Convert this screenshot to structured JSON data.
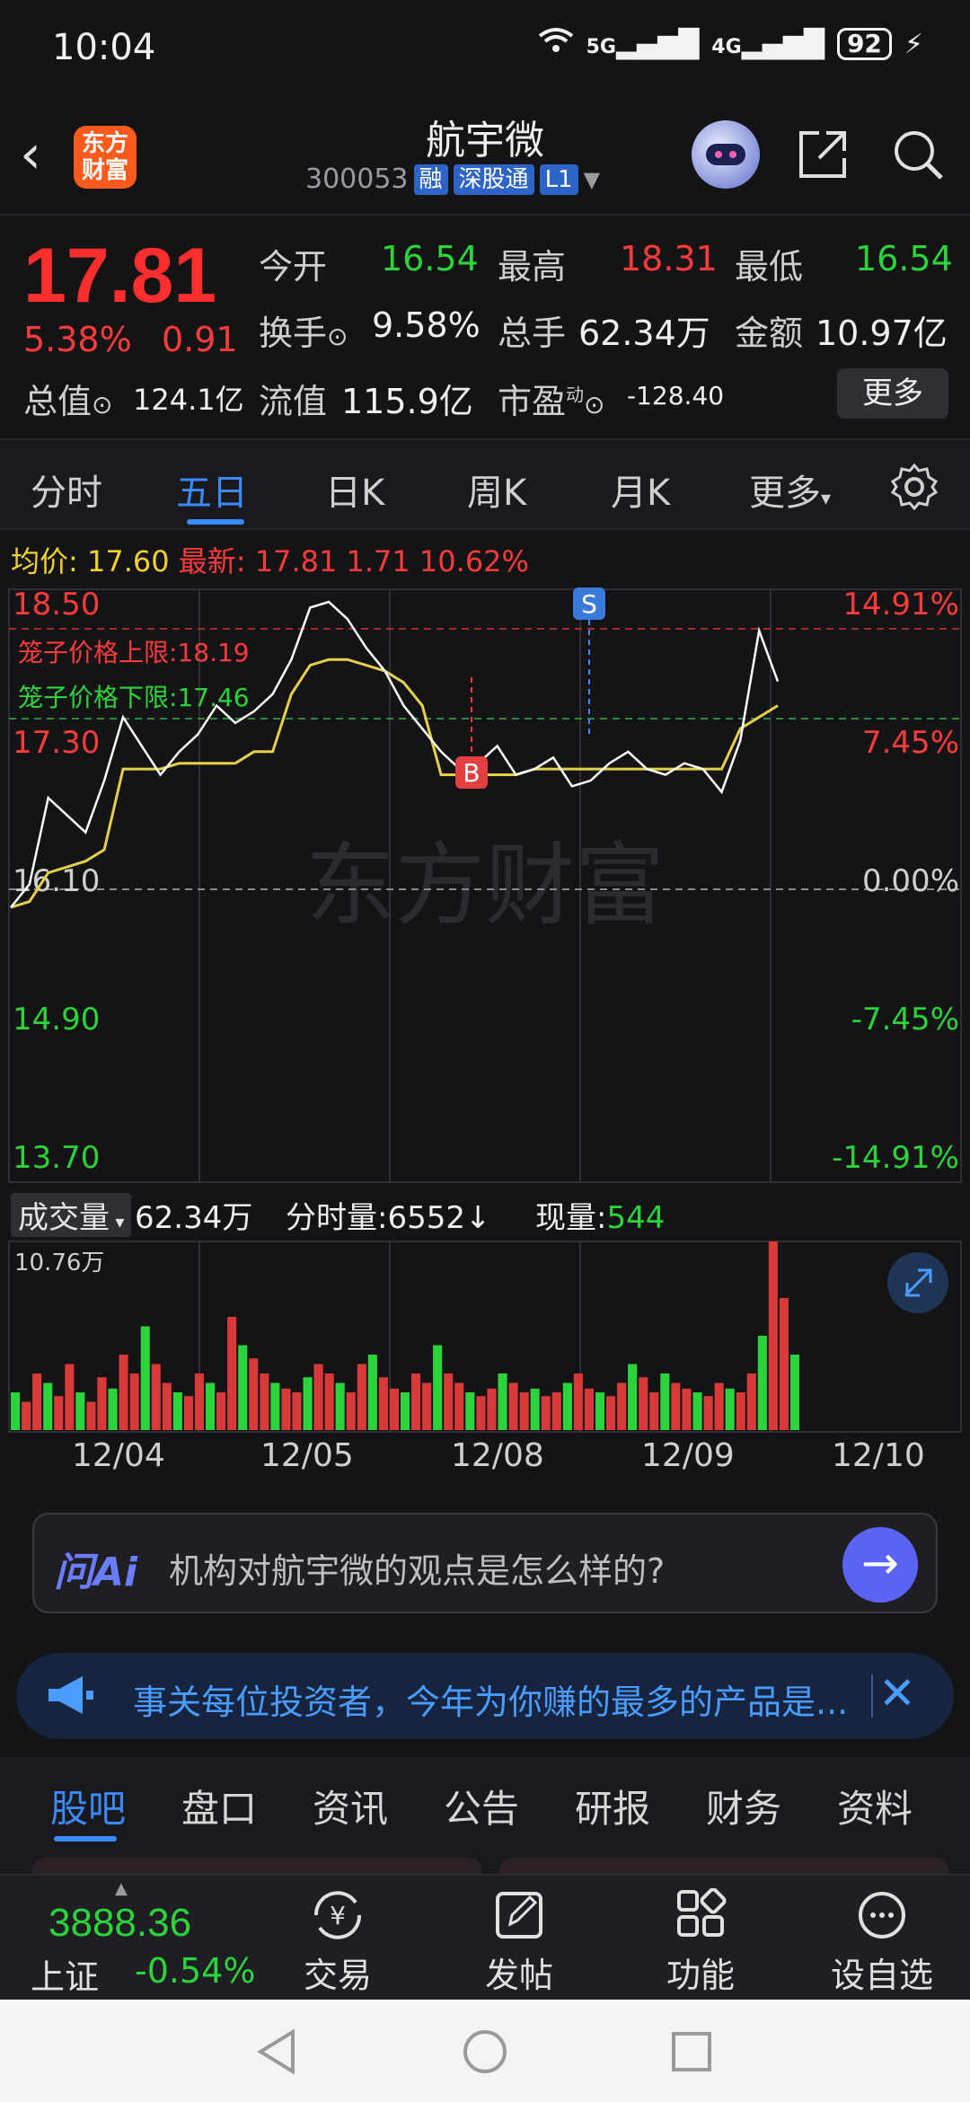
{
  "status": {
    "time": "10:04",
    "net1": "5G",
    "net2": "4G",
    "battery": "92"
  },
  "header": {
    "app_logo": "东方\n财富",
    "stock_name": "航宇微",
    "stock_code": "300053",
    "tags": [
      "融",
      "深股通",
      "L1"
    ]
  },
  "quote": {
    "price": "17.81",
    "change_pct": "5.38%",
    "change_amt": "0.91",
    "open_label": "今开",
    "open": "16.54",
    "high_label": "最高",
    "high": "18.31",
    "low_label": "最低",
    "low": "16.54",
    "turnover_label": "换手",
    "turnover": "9.58%",
    "volume_label": "总手",
    "volume": "62.34万",
    "amount_label": "金额",
    "amount": "10.97亿",
    "mktcap_label": "总值",
    "mktcap": "124.1亿",
    "float_label": "流值",
    "float": "115.9亿",
    "pe_label": "市盈",
    "pe_sup": "动",
    "pe": "-128.40",
    "more": "更多"
  },
  "tabs": [
    "分时",
    "五日",
    "日K",
    "周K",
    "月K",
    "更多"
  ],
  "active_tab": "五日",
  "chart_info": {
    "avg_label": "均价:",
    "avg": "17.60",
    "latest_label": "最新:",
    "latest": "17.81",
    "chg": "1.71",
    "pct": "10.62%"
  },
  "chart_data": {
    "type": "line",
    "y_labels_left": [
      "18.50",
      "17.30",
      "16.10",
      "14.90",
      "13.70"
    ],
    "y_labels_right": [
      "14.91%",
      "7.45%",
      "0.00%",
      "-7.45%",
      "-14.91%"
    ],
    "ylim": [
      13.7,
      18.5
    ],
    "x_labels": [
      "12/04",
      "12/05",
      "12/08",
      "12/09",
      "12/10"
    ],
    "upper_limit_label": "笼子价格上限:",
    "upper_limit": "18.19",
    "lower_limit_label": "笼子价格下限:",
    "lower_limit": "17.46",
    "markers": [
      "B",
      "S"
    ],
    "watermark": "东方财富",
    "series": [
      {
        "values": [
          15.85,
          16.05,
          16.8,
          16.65,
          16.5,
          16.95,
          17.5,
          17.25,
          17.0,
          17.2,
          17.35,
          17.6,
          17.45,
          17.55,
          17.7,
          18.0,
          18.45,
          18.5,
          18.35,
          18.1,
          17.9,
          17.6,
          17.4,
          17.2,
          17.05,
          17.1,
          17.25,
          17.0,
          17.05,
          17.15,
          16.9,
          16.95,
          17.1,
          17.2,
          17.05,
          17.0,
          17.1,
          17.05,
          16.85,
          17.3,
          18.25,
          17.81
        ]
      },
      {
        "values": [
          15.85,
          15.9,
          16.15,
          16.2,
          16.25,
          16.35,
          17.05,
          17.05,
          17.05,
          17.1,
          17.1,
          17.1,
          17.1,
          17.2,
          17.2,
          17.7,
          17.95,
          18.0,
          18.0,
          17.95,
          17.9,
          17.8,
          17.6,
          17.0,
          17.0,
          17.0,
          17.0,
          17.0,
          17.05,
          17.05,
          17.05,
          17.05,
          17.05,
          17.05,
          17.05,
          17.05,
          17.05,
          17.05,
          17.05,
          17.4,
          17.5,
          17.6
        ]
      }
    ]
  },
  "volume": {
    "label": "成交量",
    "total": "62.34万",
    "tick_label": "分时量:",
    "tick_vol": "6552↓",
    "now_label": "现量:",
    "now_vol": "544",
    "max_label": "10.76万",
    "bars": [
      0.2,
      0.15,
      0.3,
      0.25,
      0.18,
      0.35,
      0.2,
      0.15,
      0.28,
      0.22,
      0.4,
      0.3,
      0.55,
      0.35,
      0.25,
      0.2,
      0.18,
      0.3,
      0.25,
      0.2,
      0.6,
      0.45,
      0.38,
      0.3,
      0.25,
      0.22,
      0.2,
      0.28,
      0.35,
      0.3,
      0.25,
      0.2,
      0.35,
      0.4,
      0.28,
      0.22,
      0.2,
      0.3,
      0.25,
      0.45,
      0.3,
      0.25,
      0.2,
      0.18,
      0.22,
      0.3,
      0.25,
      0.2,
      0.22,
      0.18,
      0.2,
      0.25,
      0.3,
      0.22,
      0.2,
      0.18,
      0.25,
      0.35,
      0.28,
      0.2,
      0.3,
      0.25,
      0.22,
      0.2,
      0.18,
      0.25,
      0.22,
      0.2,
      0.3,
      0.5,
      1.0,
      0.7,
      0.4
    ]
  },
  "ai": {
    "logo": "问Ai",
    "question": "机构对航宇微的观点是怎么样的?"
  },
  "notice": {
    "text": "事关每位投资者，今年为你赚的最多的产品是..."
  },
  "bottom_tabs": [
    "股吧",
    "盘口",
    "资讯",
    "公告",
    "研报",
    "财务",
    "资料"
  ],
  "index": {
    "value": "3888.36",
    "name": "上证",
    "pct": "-0.54%"
  },
  "nav": [
    "交易",
    "发帖",
    "功能",
    "设自选"
  ],
  "colors": {
    "up": "#ff3b3b",
    "down": "#2bd43b",
    "accent": "#3a8bff",
    "price_line": "#ffffff",
    "avg_line": "#e6d04a"
  }
}
